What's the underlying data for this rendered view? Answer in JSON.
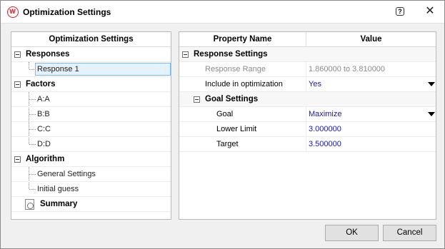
{
  "window": {
    "title": "Optimization Settings",
    "help_glyph": "?",
    "close_glyph": "✕",
    "app_icon_letter": "W"
  },
  "tree": {
    "header": "Optimization Settings",
    "responses": {
      "label": "Responses",
      "items": [
        "Response 1"
      ]
    },
    "factors": {
      "label": "Factors",
      "items": [
        "A:A",
        "B:B",
        "C:C",
        "D:D"
      ]
    },
    "algorithm": {
      "label": "Algorithm",
      "items": [
        "General Settings",
        "Initial guess"
      ]
    },
    "summary": {
      "label": "Summary"
    }
  },
  "grid": {
    "columns": {
      "property": "Property Name",
      "value": "Value"
    },
    "response_settings": {
      "label": "Response Settings",
      "response_range": {
        "name": "Response Range",
        "value": "1.860000 to 3.810000"
      },
      "include": {
        "name": "Include in optimization",
        "value": "Yes"
      }
    },
    "goal_settings": {
      "label": "Goal Settings",
      "goal": {
        "name": "Goal",
        "value": "Maximize"
      },
      "lower_limit": {
        "name": "Lower Limit",
        "value": "3.000000"
      },
      "target": {
        "name": "Target",
        "value": "3.500000"
      }
    }
  },
  "buttons": {
    "ok": "OK",
    "cancel": "Cancel"
  }
}
